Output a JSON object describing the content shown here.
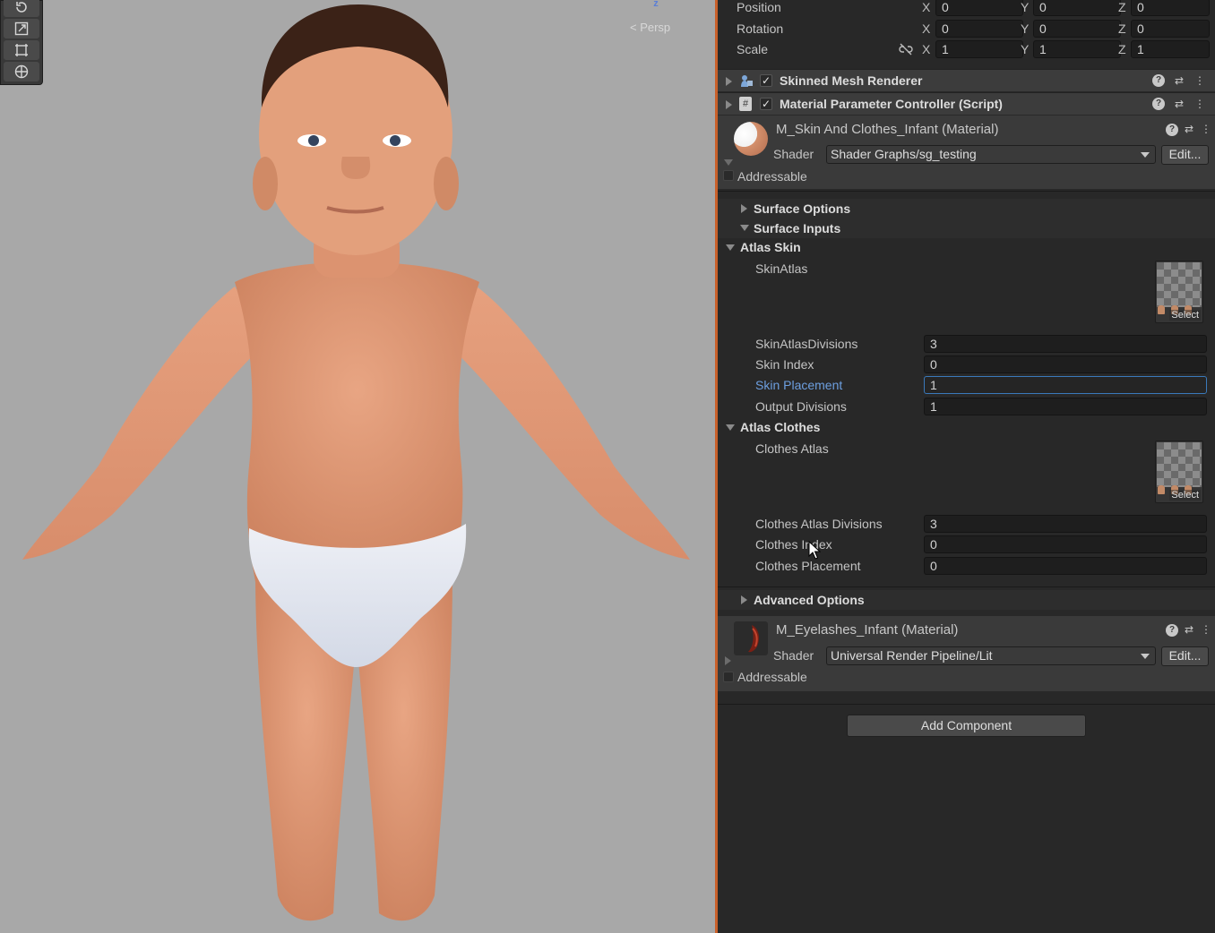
{
  "scene": {
    "view_label": "< Persp",
    "gizmo_axis": "z",
    "tools": [
      "rotate-tool-icon",
      "scale-tool-icon",
      "rect-tool-icon",
      "transform-tool-icon"
    ]
  },
  "transform": {
    "rows": [
      {
        "label": "Position",
        "x": "0",
        "y": "0",
        "z": "0"
      },
      {
        "label": "Rotation",
        "x": "0",
        "y": "0",
        "z": "0"
      },
      {
        "label": "Scale",
        "x": "1",
        "y": "1",
        "z": "1"
      }
    ],
    "axes": {
      "x": "X",
      "y": "Y",
      "z": "Z"
    }
  },
  "components": [
    {
      "name": "Skinned Mesh Renderer",
      "enabled": true
    },
    {
      "name": "Material Parameter Controller (Script)",
      "enabled": true
    }
  ],
  "material1": {
    "title": "M_Skin And Clothes_Infant (Material)",
    "shader_label": "Shader",
    "shader_value": "Shader Graphs/sg_testing",
    "edit_label": "Edit...",
    "addressable_label": "Addressable"
  },
  "sections": {
    "surface_options": "Surface Options",
    "surface_inputs": "Surface Inputs",
    "atlas_skin": "Atlas Skin",
    "atlas_clothes": "Atlas Clothes",
    "advanced_options": "Advanced Options"
  },
  "atlas_skin": {
    "texture_label": "SkinAtlas",
    "select_label": "Select",
    "properties": [
      {
        "label": "SkinAtlasDivisions",
        "value": "3"
      },
      {
        "label": "Skin Index",
        "value": "0"
      },
      {
        "label": "Skin Placement",
        "value": "1",
        "focused": true
      },
      {
        "label": "Output Divisions",
        "value": "1"
      }
    ]
  },
  "atlas_clothes": {
    "texture_label": "Clothes Atlas",
    "select_label": "Select",
    "properties": [
      {
        "label": "Clothes Atlas Divisions",
        "value": "3"
      },
      {
        "label": "Clothes Index",
        "value": "0"
      },
      {
        "label": "Clothes Placement",
        "value": "0"
      }
    ]
  },
  "material2": {
    "title": "M_Eyelashes_Infant (Material)",
    "shader_label": "Shader",
    "shader_value": "Universal Render Pipeline/Lit",
    "edit_label": "Edit...",
    "addressable_label": "Addressable"
  },
  "add_component_label": "Add Component",
  "colors": {
    "accent_orange": "#c9602a",
    "focus_blue": "#3a79bb",
    "focused_label": "#6d9fe0",
    "panel_bg": "#282828",
    "scene_bg": "#a8a8a8"
  }
}
